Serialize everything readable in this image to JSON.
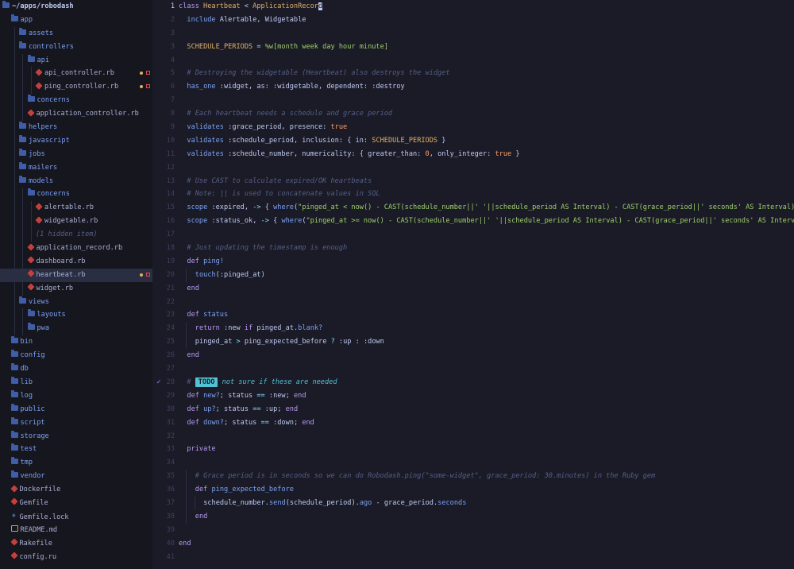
{
  "sidebar": {
    "items": [
      {
        "label": "~/apps/robodash",
        "type": "root",
        "depth": 0,
        "icon": "folder-icon"
      },
      {
        "label": "app",
        "type": "dir",
        "depth": 1,
        "icon": "folder-icon"
      },
      {
        "label": "assets",
        "type": "dir",
        "depth": 2,
        "icon": "folder-icon"
      },
      {
        "label": "controllers",
        "type": "dir",
        "depth": 2,
        "icon": "folder-icon"
      },
      {
        "label": "api",
        "type": "dir",
        "depth": 3,
        "icon": "folder-icon"
      },
      {
        "label": "api_controller.rb",
        "type": "file",
        "depth": 4,
        "icon": "ruby-icon",
        "modified": true
      },
      {
        "label": "ping_controller.rb",
        "type": "file",
        "depth": 4,
        "icon": "ruby-icon",
        "modified": true
      },
      {
        "label": "concerns",
        "type": "dir",
        "depth": 3,
        "icon": "folder-icon"
      },
      {
        "label": "application_controller.rb",
        "type": "file",
        "depth": 3,
        "icon": "ruby-icon"
      },
      {
        "label": "helpers",
        "type": "dir",
        "depth": 2,
        "icon": "folder-icon"
      },
      {
        "label": "javascript",
        "type": "dir",
        "depth": 2,
        "icon": "folder-icon"
      },
      {
        "label": "jobs",
        "type": "dir",
        "depth": 2,
        "icon": "folder-icon"
      },
      {
        "label": "mailers",
        "type": "dir",
        "depth": 2,
        "icon": "folder-icon"
      },
      {
        "label": "models",
        "type": "dir",
        "depth": 2,
        "icon": "folder-icon"
      },
      {
        "label": "concerns",
        "type": "dir",
        "depth": 3,
        "icon": "folder-icon"
      },
      {
        "label": "alertable.rb",
        "type": "file",
        "depth": 4,
        "icon": "ruby-icon"
      },
      {
        "label": "widgetable.rb",
        "type": "file",
        "depth": 4,
        "icon": "ruby-icon"
      },
      {
        "label": "(1 hidden item)",
        "type": "muted",
        "depth": 4,
        "icon": ""
      },
      {
        "label": "application_record.rb",
        "type": "file",
        "depth": 3,
        "icon": "ruby-icon"
      },
      {
        "label": "dashboard.rb",
        "type": "file",
        "depth": 3,
        "icon": "ruby-icon"
      },
      {
        "label": "heartbeat.rb",
        "type": "file",
        "depth": 3,
        "icon": "ruby-icon",
        "modified": true,
        "selected": true
      },
      {
        "label": "widget.rb",
        "type": "file",
        "depth": 3,
        "icon": "ruby-icon"
      },
      {
        "label": "views",
        "type": "dir",
        "depth": 2,
        "icon": "folder-icon"
      },
      {
        "label": "layouts",
        "type": "dir",
        "depth": 3,
        "icon": "folder-icon"
      },
      {
        "label": "pwa",
        "type": "dir",
        "depth": 3,
        "icon": "folder-icon"
      },
      {
        "label": "bin",
        "type": "dir",
        "depth": 1,
        "icon": "folder-icon"
      },
      {
        "label": "config",
        "type": "dir",
        "depth": 1,
        "icon": "folder-icon"
      },
      {
        "label": "db",
        "type": "dir",
        "depth": 1,
        "icon": "folder-icon"
      },
      {
        "label": "lib",
        "type": "dir",
        "depth": 1,
        "icon": "folder-icon"
      },
      {
        "label": "log",
        "type": "dir",
        "depth": 1,
        "icon": "folder-icon"
      },
      {
        "label": "public",
        "type": "dir",
        "depth": 1,
        "icon": "folder-icon"
      },
      {
        "label": "script",
        "type": "dir",
        "depth": 1,
        "icon": "folder-icon"
      },
      {
        "label": "storage",
        "type": "dir",
        "depth": 1,
        "icon": "folder-icon"
      },
      {
        "label": "test",
        "type": "dir",
        "depth": 1,
        "icon": "folder-icon"
      },
      {
        "label": "tmp",
        "type": "dir",
        "depth": 1,
        "icon": "folder-icon"
      },
      {
        "label": "vendor",
        "type": "dir",
        "depth": 1,
        "icon": "folder-icon"
      },
      {
        "label": "Dockerfile",
        "type": "file",
        "depth": 1,
        "icon": "docker-icon"
      },
      {
        "label": "Gemfile",
        "type": "file",
        "depth": 1,
        "icon": "ruby-icon"
      },
      {
        "label": "Gemfile.lock",
        "type": "file",
        "depth": 1,
        "icon": "star-icon"
      },
      {
        "label": "README.md",
        "type": "file",
        "depth": 1,
        "icon": "readme-icon"
      },
      {
        "label": "Rakefile",
        "type": "file",
        "depth": 1,
        "icon": "ruby-icon"
      },
      {
        "label": "config.ru",
        "type": "file",
        "depth": 1,
        "icon": "ruby-icon"
      }
    ]
  },
  "editor": {
    "current_line": "1",
    "lines": [
      {
        "no": "1",
        "indent": 0,
        "tokens": [
          [
            "kw",
            "class "
          ],
          [
            "cls",
            "Heartbeat"
          ],
          [
            "plain",
            " < "
          ],
          [
            "cls",
            "ApplicationRecor"
          ],
          [
            "cursor",
            "d"
          ]
        ]
      },
      {
        "no": "2",
        "indent": 1,
        "tokens": [
          [
            "fn",
            "include "
          ],
          [
            "plain",
            "Alertable, Widgetable"
          ]
        ]
      },
      {
        "no": "3",
        "indent": 0,
        "tokens": []
      },
      {
        "no": "3",
        "indent": 1,
        "tokens": [
          [
            "const",
            "SCHEDULE_PERIODS"
          ],
          [
            "plain",
            " = "
          ],
          [
            "str",
            "%w[month week day hour minute]"
          ]
        ]
      },
      {
        "no": "4",
        "indent": 0,
        "tokens": []
      },
      {
        "no": "5",
        "indent": 1,
        "tokens": [
          [
            "cmt",
            "# Destroying the widgetable (Heartbeat) also destroys the widget"
          ]
        ]
      },
      {
        "no": "6",
        "indent": 1,
        "tokens": [
          [
            "fn",
            "has_one "
          ],
          [
            "sym",
            ":widget"
          ],
          [
            "plain",
            ", "
          ],
          [
            "sym",
            "as: :widgetable"
          ],
          [
            "plain",
            ", "
          ],
          [
            "sym",
            "dependent: :destroy"
          ]
        ]
      },
      {
        "no": "7",
        "indent": 0,
        "tokens": []
      },
      {
        "no": "8",
        "indent": 1,
        "tokens": [
          [
            "cmt",
            "# Each heartbeat needs a schedule and grace period"
          ]
        ]
      },
      {
        "no": "9",
        "indent": 1,
        "tokens": [
          [
            "fn",
            "validates "
          ],
          [
            "sym",
            ":grace_period"
          ],
          [
            "plain",
            ", "
          ],
          [
            "sym",
            "presence: "
          ],
          [
            "bool",
            "true"
          ]
        ]
      },
      {
        "no": "10",
        "indent": 1,
        "tokens": [
          [
            "fn",
            "validates "
          ],
          [
            "sym",
            ":schedule_period"
          ],
          [
            "plain",
            ", "
          ],
          [
            "sym",
            "inclusion: "
          ],
          [
            "plain",
            "{ "
          ],
          [
            "sym",
            "in: "
          ],
          [
            "const",
            "SCHEDULE_PERIODS"
          ],
          [
            "plain",
            " }"
          ]
        ]
      },
      {
        "no": "11",
        "indent": 1,
        "tokens": [
          [
            "fn",
            "validates "
          ],
          [
            "sym",
            ":schedule_number"
          ],
          [
            "plain",
            ", "
          ],
          [
            "sym",
            "numericality: "
          ],
          [
            "plain",
            "{ "
          ],
          [
            "sym",
            "greater_than: "
          ],
          [
            "num",
            "0"
          ],
          [
            "plain",
            ", "
          ],
          [
            "sym",
            "only_integer: "
          ],
          [
            "bool",
            "true"
          ],
          [
            "plain",
            " }"
          ]
        ]
      },
      {
        "no": "12",
        "indent": 0,
        "tokens": []
      },
      {
        "no": "13",
        "indent": 1,
        "tokens": [
          [
            "cmt",
            "# Use CAST to calculate expired/OK heartbeats"
          ]
        ]
      },
      {
        "no": "14",
        "indent": 1,
        "tokens": [
          [
            "cmt",
            "# Note: || is used to concatenate values in SQL"
          ]
        ]
      },
      {
        "no": "15",
        "indent": 1,
        "tokens": [
          [
            "fn",
            "scope "
          ],
          [
            "sym",
            ":expired"
          ],
          [
            "plain",
            ", "
          ],
          [
            "op",
            "-> "
          ],
          [
            "plain",
            "{ "
          ],
          [
            "fn",
            "where"
          ],
          [
            "plain",
            "("
          ],
          [
            "str",
            "\"pinged_at < now() - CAST(schedule_number||' '||schedule_period AS Interval) - CAST(grace_period||' seconds' AS Interval)\""
          ],
          [
            "plain",
            ") }"
          ]
        ]
      },
      {
        "no": "16",
        "indent": 1,
        "tokens": [
          [
            "fn",
            "scope "
          ],
          [
            "sym",
            ":status_ok"
          ],
          [
            "plain",
            ", "
          ],
          [
            "op",
            "-> "
          ],
          [
            "plain",
            "{ "
          ],
          [
            "fn",
            "where"
          ],
          [
            "plain",
            "("
          ],
          [
            "str",
            "\"pinged_at >= now() - CAST(schedule_number||' '||schedule_period AS Interval) - CAST(grace_period||' seconds' AS Interval)\""
          ],
          [
            "plain",
            ") }"
          ]
        ]
      },
      {
        "no": "17",
        "indent": 0,
        "tokens": []
      },
      {
        "no": "18",
        "indent": 1,
        "tokens": [
          [
            "cmt",
            "# Just updating the timestamp is enough"
          ]
        ]
      },
      {
        "no": "19",
        "indent": 1,
        "tokens": [
          [
            "kw",
            "def "
          ],
          [
            "fn",
            "ping!"
          ]
        ]
      },
      {
        "no": "20",
        "indent": 2,
        "tokens": [
          [
            "fn",
            "touch"
          ],
          [
            "plain",
            "("
          ],
          [
            "sym",
            ":pinged_at"
          ],
          [
            "plain",
            ")"
          ]
        ]
      },
      {
        "no": "21",
        "indent": 1,
        "tokens": [
          [
            "kw",
            "end"
          ]
        ]
      },
      {
        "no": "22",
        "indent": 0,
        "tokens": []
      },
      {
        "no": "23",
        "indent": 1,
        "tokens": [
          [
            "kw",
            "def "
          ],
          [
            "fn",
            "status"
          ]
        ]
      },
      {
        "no": "24",
        "indent": 2,
        "tokens": [
          [
            "kw",
            "return "
          ],
          [
            "sym",
            ":new "
          ],
          [
            "kw",
            "if "
          ],
          [
            "plain",
            "pinged_at."
          ],
          [
            "fn",
            "blank?"
          ]
        ]
      },
      {
        "no": "25",
        "indent": 2,
        "tokens": [
          [
            "plain",
            "pinged_at "
          ],
          [
            "op",
            "> "
          ],
          [
            "plain",
            "ping_expected_before "
          ],
          [
            "op",
            "? "
          ],
          [
            "sym",
            ":up "
          ],
          [
            "op",
            ": "
          ],
          [
            "sym",
            ":down"
          ]
        ]
      },
      {
        "no": "26",
        "indent": 1,
        "tokens": [
          [
            "kw",
            "end"
          ]
        ]
      },
      {
        "no": "27",
        "indent": 0,
        "tokens": []
      },
      {
        "no": "28",
        "indent": 1,
        "mark": "✓",
        "tokens": [
          [
            "cmt",
            "# "
          ],
          [
            "todo",
            "TODO"
          ],
          [
            "todotext",
            " not sure if these are needed"
          ]
        ]
      },
      {
        "no": "29",
        "indent": 1,
        "tokens": [
          [
            "kw",
            "def "
          ],
          [
            "fn",
            "new?"
          ],
          [
            "plain",
            "; status "
          ],
          [
            "op",
            "== "
          ],
          [
            "sym",
            ":new"
          ],
          [
            "plain",
            "; "
          ],
          [
            "kw",
            "end"
          ]
        ]
      },
      {
        "no": "30",
        "indent": 1,
        "tokens": [
          [
            "kw",
            "def "
          ],
          [
            "fn",
            "up?"
          ],
          [
            "plain",
            "; status "
          ],
          [
            "op",
            "== "
          ],
          [
            "sym",
            ":up"
          ],
          [
            "plain",
            "; "
          ],
          [
            "kw",
            "end"
          ]
        ]
      },
      {
        "no": "31",
        "indent": 1,
        "tokens": [
          [
            "kw",
            "def "
          ],
          [
            "fn",
            "down?"
          ],
          [
            "plain",
            "; status "
          ],
          [
            "op",
            "== "
          ],
          [
            "sym",
            ":down"
          ],
          [
            "plain",
            "; "
          ],
          [
            "kw",
            "end"
          ]
        ]
      },
      {
        "no": "32",
        "indent": 0,
        "tokens": []
      },
      {
        "no": "33",
        "indent": 1,
        "tokens": [
          [
            "kw",
            "private"
          ]
        ]
      },
      {
        "no": "34",
        "indent": 0,
        "tokens": []
      },
      {
        "no": "35",
        "indent": 2,
        "tokens": [
          [
            "cmt",
            "# Grace period is in seconds so we can do Robodash.ping(\"some-widget\", grace_period: 30.minutes) in the Ruby gem"
          ]
        ]
      },
      {
        "no": "36",
        "indent": 2,
        "tokens": [
          [
            "kw",
            "def "
          ],
          [
            "fn",
            "ping_expected_before"
          ]
        ]
      },
      {
        "no": "37",
        "indent": 3,
        "tokens": [
          [
            "plain",
            "schedule_number."
          ],
          [
            "fn",
            "send"
          ],
          [
            "plain",
            "(schedule_period)."
          ],
          [
            "fn",
            "ago"
          ],
          [
            "plain",
            " - grace_period."
          ],
          [
            "fn",
            "seconds"
          ]
        ]
      },
      {
        "no": "38",
        "indent": 2,
        "tokens": [
          [
            "kw",
            "end"
          ]
        ]
      },
      {
        "no": "39",
        "indent": 0,
        "tokens": []
      },
      {
        "no": "40",
        "indent": 0,
        "tokens": [
          [
            "kw",
            "end"
          ]
        ]
      },
      {
        "no": "41",
        "indent": 0,
        "tokens": []
      }
    ]
  }
}
